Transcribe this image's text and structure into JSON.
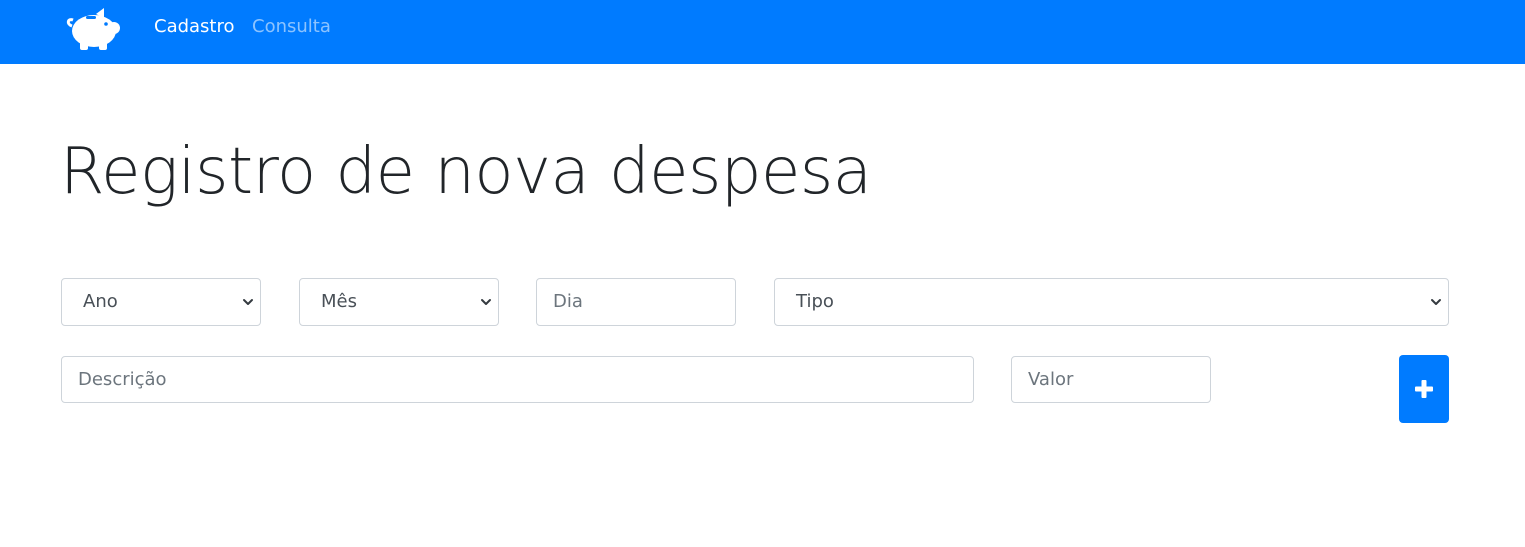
{
  "nav": {
    "brand_icon": "piggy-bank-icon",
    "links": [
      {
        "label": "Cadastro",
        "active": true
      },
      {
        "label": "Consulta",
        "active": false
      }
    ],
    "background_color": "#007bff"
  },
  "main": {
    "title": "Registro de nova despesa",
    "form": {
      "ano_select": {
        "selected": "Ano"
      },
      "mes_select": {
        "selected": "Mês"
      },
      "dia_input": {
        "placeholder": "Dia",
        "value": ""
      },
      "tipo_select": {
        "selected": "Tipo"
      },
      "descricao_input": {
        "placeholder": "Descrição",
        "value": ""
      },
      "valor_input": {
        "placeholder": "Valor",
        "value": ""
      },
      "add_button": {
        "icon": "plus-icon",
        "color": "#007bff"
      }
    }
  }
}
